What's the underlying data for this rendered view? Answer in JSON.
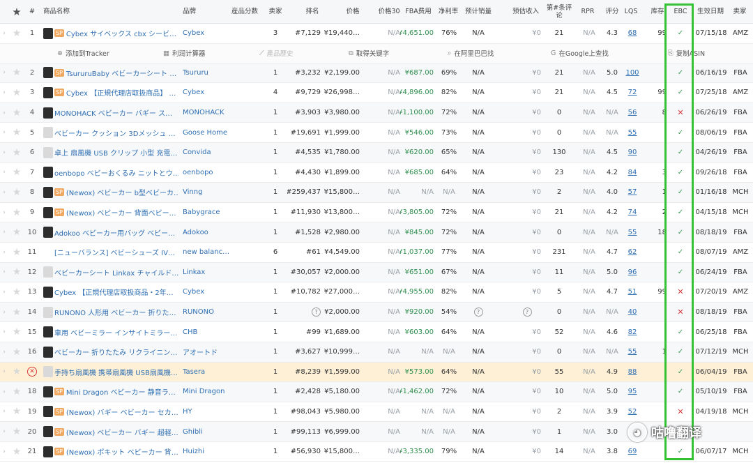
{
  "header": {
    "star": "★",
    "num": "#",
    "name": "商品名称",
    "brand": "品牌",
    "category": "産品分数",
    "sellers": "卖家",
    "rank": "排名",
    "price": "价格",
    "price30": "价格30",
    "fba_fee": "FBA费用",
    "margin": "净利率",
    "est_sales": "预计销量",
    "est_revenue": "预估收入",
    "reviews": "第#条评论",
    "rpr": "RPR",
    "rating": "评分",
    "lqs": "LQS",
    "stock": "库存",
    "ebc": "EBC",
    "date": "生效日期",
    "seller_type": "卖家"
  },
  "actions": {
    "tracker": "添加到Tracker",
    "calc": "利润计算器",
    "history": "產品歷史",
    "keywords": "取得关键字",
    "alibaba": "在阿里巴巴找",
    "google": "在Google上查找",
    "copy": "复制ASIN"
  },
  "rows": [
    {
      "n": "1",
      "sp": true,
      "thumb": "dark",
      "name": "Cybex サイベックス cbx シービ…",
      "brand": "Cybex",
      "cat": "3",
      "rank": "#7,129",
      "price": "¥19,440…",
      "p30": "N/A",
      "fba": "¥4,651.00",
      "margin": "76%",
      "sales": "N/A",
      "rev": "¥0",
      "rev_n": "21",
      "rpr": "N/A",
      "rating": "4.3",
      "lqs": "68",
      "stock": "99",
      "ebc": "ok",
      "date": "07/15/18",
      "seller": "AMZ"
    },
    {
      "n": "2",
      "sp": true,
      "thumb": "dark",
      "name": "TsururuBaby ベビーカーシート …",
      "brand": "Tsururu",
      "cat": "1",
      "rank": "#3,232",
      "price": "¥2,199.00",
      "p30": "N/A",
      "fba": "¥687.00",
      "margin": "69%",
      "sales": "N/A",
      "rev": "¥0",
      "rev_n": "21",
      "rpr": "N/A",
      "rating": "5.0",
      "lqs": "100",
      "stock": "",
      "ebc": "ok",
      "date": "06/16/19",
      "seller": "FBA"
    },
    {
      "n": "3",
      "sp": true,
      "thumb": "dark",
      "name": "Cybex 【正規代理店取扱商品】 …",
      "brand": "Cybex",
      "cat": "4",
      "rank": "#9,729",
      "price": "¥26,998…",
      "p30": "N/A",
      "fba": "¥4,896.00",
      "margin": "82%",
      "sales": "N/A",
      "rev": "¥0",
      "rev_n": "21",
      "rpr": "N/A",
      "rating": "4.5",
      "lqs": "72",
      "stock": "99",
      "ebc": "ok",
      "date": "07/25/18",
      "seller": "AMZ"
    },
    {
      "n": "4",
      "sp": false,
      "thumb": "dark",
      "name": "MONOHACK ベビーカー バギー ス…",
      "brand": "MONOHACK",
      "cat": "1",
      "rank": "#3,903",
      "price": "¥3,980.00",
      "p30": "N/A",
      "fba": "¥1,100.00",
      "margin": "72%",
      "sales": "N/A",
      "rev": "¥0",
      "rev_n": "0",
      "rpr": "N/A",
      "rating": "N/A",
      "lqs": "56",
      "stock": "8",
      "ebc": "no",
      "date": "06/26/19",
      "seller": "FBA"
    },
    {
      "n": "5",
      "sp": false,
      "thumb": "light",
      "name": "ベビーカー クッション 3Dメッシュ …",
      "brand": "Goose Home",
      "cat": "1",
      "rank": "#19,691",
      "price": "¥1,999.00",
      "p30": "N/A",
      "fba": "¥546.00",
      "margin": "73%",
      "sales": "N/A",
      "rev": "¥0",
      "rev_n": "0",
      "rpr": "N/A",
      "rating": "N/A",
      "lqs": "55",
      "stock": "",
      "ebc": "ok",
      "date": "08/06/19",
      "seller": "FBA"
    },
    {
      "n": "6",
      "sp": false,
      "thumb": "light",
      "name": "卓上 扇風機 USB クリップ 小型 充電…",
      "brand": "Convida",
      "cat": "1",
      "rank": "#4,535",
      "price": "¥1,780.00",
      "p30": "N/A",
      "fba": "¥620.00",
      "margin": "65%",
      "sales": "N/A",
      "rev": "¥0",
      "rev_n": "130",
      "rpr": "N/A",
      "rating": "4.5",
      "lqs": "90",
      "stock": "",
      "ebc": "ok",
      "date": "04/26/19",
      "seller": "FBA"
    },
    {
      "n": "7",
      "sp": false,
      "thumb": "dark",
      "name": "oenbopo ベビーおくるみ ニットとウ…",
      "brand": "oenbopo",
      "cat": "1",
      "rank": "#4,430",
      "price": "¥1,899.00",
      "p30": "N/A",
      "fba": "¥685.00",
      "margin": "64%",
      "sales": "N/A",
      "rev": "¥0",
      "rev_n": "23",
      "rpr": "N/A",
      "rating": "4.2",
      "lqs": "84",
      "stock": "3",
      "ebc": "ok",
      "date": "09/26/18",
      "seller": "FBA"
    },
    {
      "n": "8",
      "sp": true,
      "thumb": "dark",
      "name": "(Newox) ベビーカー b型ベビーカ…",
      "brand": "Vinng",
      "cat": "1",
      "rank": "#259,437",
      "price": "¥15,800…",
      "p30": "N/A",
      "fba": "N/A",
      "margin": "N/A",
      "sales": "N/A",
      "rev": "¥0",
      "rev_n": "2",
      "rpr": "N/A",
      "rating": "4.0",
      "lqs": "57",
      "stock": "1",
      "ebc": "ok",
      "date": "01/16/18",
      "seller": "MCH"
    },
    {
      "n": "9",
      "sp": true,
      "thumb": "dark",
      "name": "(Newox) ベビーカー 背面ベビー…",
      "brand": "Babygrace",
      "cat": "1",
      "rank": "#11,930",
      "price": "¥13,800…",
      "p30": "N/A",
      "fba": "¥3,805.00",
      "margin": "72%",
      "sales": "N/A",
      "rev": "¥0",
      "rev_n": "21",
      "rpr": "N/A",
      "rating": "4.2",
      "lqs": "74",
      "stock": "2",
      "ebc": "ok",
      "date": "04/15/18",
      "seller": "MCH"
    },
    {
      "n": "10",
      "sp": false,
      "thumb": "dark",
      "name": "Adokoo ベビーカー用バッグ ベビー…",
      "brand": "Adokoo",
      "cat": "1",
      "rank": "#1,528",
      "price": "¥2,980.00",
      "p30": "N/A",
      "fba": "¥845.00",
      "margin": "72%",
      "sales": "N/A",
      "rev": "¥0",
      "rev_n": "0",
      "rpr": "N/A",
      "rating": "N/A",
      "lqs": "55",
      "stock": "18",
      "ebc": "ok",
      "date": "08/18/19",
      "seller": "FBA"
    },
    {
      "n": "11",
      "sp": false,
      "thumb": "none",
      "name": "[ニューバランス] ベビーシューズ IV…",
      "brand": "new balanc…",
      "cat": "6",
      "rank": "#61",
      "price": "¥4,549.00",
      "p30": "N/A",
      "fba": "¥1,037.00",
      "margin": "77%",
      "sales": "N/A",
      "rev": "¥0",
      "rev_n": "231",
      "rpr": "N/A",
      "rating": "4.7",
      "lqs": "62",
      "stock": "",
      "ebc": "ok",
      "date": "08/07/19",
      "seller": "AMZ"
    },
    {
      "n": "12",
      "sp": false,
      "thumb": "light",
      "name": "ベビーカーシート Linkax チャイルド…",
      "brand": "Linkax",
      "cat": "1",
      "rank": "#30,057",
      "price": "¥2,000.00",
      "p30": "N/A",
      "fba": "¥651.00",
      "margin": "67%",
      "sales": "N/A",
      "rev": "¥0",
      "rev_n": "11",
      "rpr": "N/A",
      "rating": "5.0",
      "lqs": "96",
      "stock": "",
      "ebc": "ok",
      "date": "06/24/19",
      "seller": "FBA"
    },
    {
      "n": "13",
      "sp": false,
      "thumb": "dark",
      "name": "Cybex 【正規代理店取扱商品・2年…",
      "brand": "Cybex",
      "cat": "1",
      "rank": "#10,782",
      "price": "¥27,000…",
      "p30": "N/A",
      "fba": "¥4,955.00",
      "margin": "82%",
      "sales": "N/A",
      "rev": "¥0",
      "rev_n": "5",
      "rpr": "N/A",
      "rating": "4.7",
      "lqs": "51",
      "stock": "99",
      "ebc": "no",
      "date": "07/20/19",
      "seller": "AMZ"
    },
    {
      "n": "14",
      "sp": false,
      "thumb": "light",
      "name": "RUNONO 人形用 ベビーカー 折りた…",
      "brand": "RUNONO",
      "cat": "1",
      "rank": "?",
      "price": "¥2,000.00",
      "p30": "N/A",
      "fba": "¥920.00",
      "margin": "54%",
      "sales": "?",
      "rev": "?",
      "rev_n": "0",
      "rpr": "N/A",
      "rating": "N/A",
      "lqs": "40",
      "stock": "",
      "ebc": "no",
      "date": "08/18/19",
      "seller": "FBA"
    },
    {
      "n": "15",
      "sp": false,
      "thumb": "dark",
      "name": "車用 ベビーミラー インサイトミラー…",
      "brand": "CHB",
      "cat": "1",
      "rank": "#99",
      "price": "¥1,689.00",
      "p30": "N/A",
      "fba": "¥603.00",
      "margin": "64%",
      "sales": "N/A",
      "rev": "¥0",
      "rev_n": "52",
      "rpr": "N/A",
      "rating": "4.6",
      "lqs": "82",
      "stock": "",
      "ebc": "ok",
      "date": "06/25/18",
      "seller": "FBA"
    },
    {
      "n": "16",
      "sp": false,
      "thumb": "dark",
      "name": "ベビーカー 折りたたみ リクライニン…",
      "brand": "アオートド",
      "cat": "1",
      "rank": "#3,627",
      "price": "¥10,999…",
      "p30": "N/A",
      "fba": "N/A",
      "margin": "N/A",
      "sales": "N/A",
      "rev": "¥0",
      "rev_n": "0",
      "rpr": "N/A",
      "rating": "N/A",
      "lqs": "55",
      "stock": "1",
      "ebc": "ok",
      "date": "07/12/19",
      "seller": "MCH"
    },
    {
      "n": "",
      "sp": false,
      "thumb": "light",
      "name": "手持ち扇風機 携帯扇風機 USB扇風機…",
      "brand": "Tasera",
      "cat": "1",
      "rank": "#8,239",
      "price": "¥1,599.00",
      "p30": "N/A",
      "fba": "¥573.00",
      "margin": "64%",
      "sales": "N/A",
      "rev": "¥0",
      "rev_n": "55",
      "rpr": "N/A",
      "rating": "4.9",
      "lqs": "88",
      "stock": "",
      "ebc": "ok",
      "date": "06/04/19",
      "seller": "FBA"
    },
    {
      "n": "18",
      "sp": true,
      "thumb": "dark",
      "name": "Mini Dragon ベビーカー 静音ラ…",
      "brand": "Mini Dragon",
      "cat": "1",
      "rank": "#2,428",
      "price": "¥5,180.00",
      "p30": "N/A",
      "fba": "¥1,462.00",
      "margin": "72%",
      "sales": "N/A",
      "rev": "¥0",
      "rev_n": "10",
      "rpr": "N/A",
      "rating": "5.0",
      "lqs": "95",
      "stock": "",
      "ebc": "ok",
      "date": "05/10/19",
      "seller": "FBA"
    },
    {
      "n": "19",
      "sp": true,
      "thumb": "dark",
      "name": "(Newox) バギー ベビーカー セカ…",
      "brand": "HY",
      "cat": "1",
      "rank": "#98,043",
      "price": "¥5,980.00",
      "p30": "N/A",
      "fba": "N/A",
      "margin": "N/A",
      "sales": "N/A",
      "rev": "¥0",
      "rev_n": "2",
      "rpr": "N/A",
      "rating": "3.9",
      "lqs": "52",
      "stock": "",
      "ebc": "no",
      "date": "04/19/18",
      "seller": "MCH"
    },
    {
      "n": "20",
      "sp": true,
      "thumb": "dark",
      "name": "(Newox) ベビーカー バギー 超軽…",
      "brand": "Ghibli",
      "cat": "1",
      "rank": "#99,113",
      "price": "¥6,999.00",
      "p30": "N/A",
      "fba": "N/A",
      "margin": "N/A",
      "sales": "N/A",
      "rev": "¥0",
      "rev_n": "1",
      "rpr": "N/A",
      "rating": "3.0",
      "lqs": "",
      "stock": "",
      "ebc": "ok",
      "date": "",
      "seller": ""
    },
    {
      "n": "21",
      "sp": true,
      "thumb": "dark",
      "name": "(Newox) ポキット ベビーカー 背…",
      "brand": "Huizhi",
      "cat": "1",
      "rank": "#56,930",
      "price": "¥15,800…",
      "p30": "N/A",
      "fba": "¥3,335.00",
      "margin": "79%",
      "sales": "N/A",
      "rev": "¥0",
      "rev_n": "14",
      "rpr": "N/A",
      "rating": "3.8",
      "lqs": "69",
      "stock": "",
      "ebc": "ok",
      "date": "06/07/17",
      "seller": "MCH"
    }
  ],
  "highlight_row_index": 16,
  "watermark": "咕噜翻译",
  "colors": {
    "ebc_box": "#32c232",
    "ok": "#3b9e58",
    "no": "#d93b3b",
    "highlight": "#fdf0d6",
    "link": "#2f6fb3"
  }
}
